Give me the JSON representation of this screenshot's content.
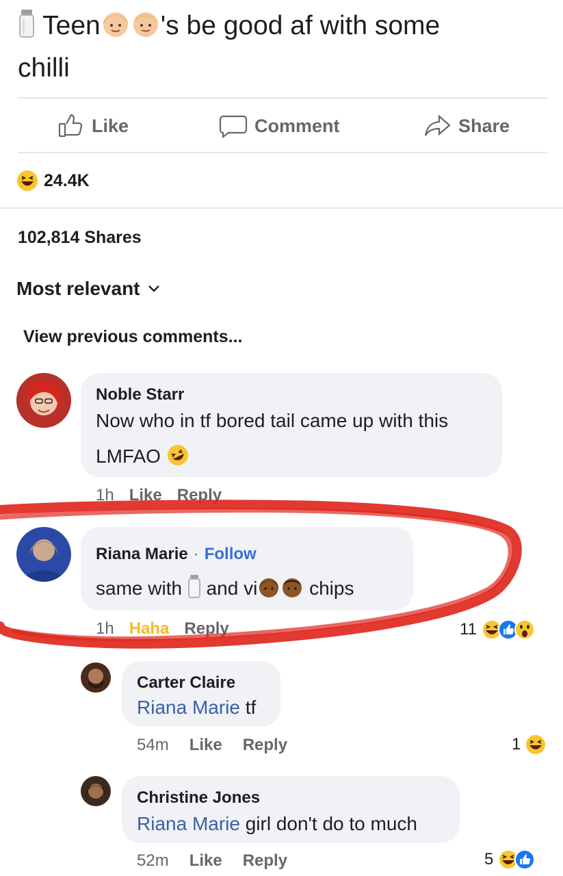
{
  "post": {
    "text_before": "Teen",
    "text_after": "'s be good af with some",
    "text_line2": "chilli"
  },
  "actions": {
    "like_label": "Like",
    "comment_label": "Comment",
    "share_label": "Share"
  },
  "stats": {
    "reactions_count": "24.4K",
    "shares_text": "102,814 Shares"
  },
  "sort": {
    "label": "Most relevant"
  },
  "view_previous": "View previous comments...",
  "comments": [
    {
      "author": "Noble Starr",
      "line1": "Now who in tf bored tail came up with this",
      "line2": "LMFAO",
      "time": "1h",
      "like_label": "Like",
      "reply_label": "Reply"
    },
    {
      "author": "Riana Marie",
      "follow_label": "Follow",
      "text_a": "same with",
      "text_b": "and vi",
      "text_c": "chips",
      "time": "1h",
      "reaction_label": "Haha",
      "reply_label": "Reply",
      "reaction_count": "11"
    },
    {
      "author": "Carter Claire",
      "mention": "Riana Marie",
      "text": " tf",
      "time": "54m",
      "like_label": "Like",
      "reply_label": "Reply",
      "reaction_count": "1"
    },
    {
      "author": "Christine Jones",
      "mention": "Riana Marie",
      "text": " girl don't do to much",
      "time": "52m",
      "like_label": "Like",
      "reply_label": "Reply",
      "reaction_count": "5"
    }
  ],
  "annotation_color": "#e0281f",
  "icons": [
    "salt-shaker-icon",
    "woman-face-icon",
    "man-face-icon",
    "like-icon",
    "comment-icon",
    "share-icon",
    "haha-reaction-icon",
    "chevron-down-icon",
    "rofl-emoji-icon",
    "like-reaction-icon",
    "wow-reaction-icon"
  ]
}
